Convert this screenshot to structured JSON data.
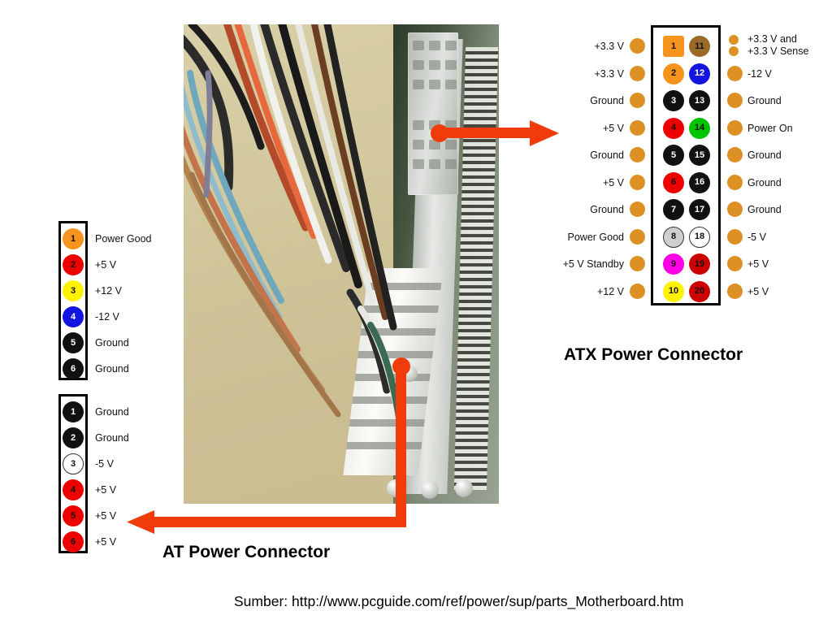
{
  "colors": {
    "arrow": "#F03C0A",
    "gold": "#DD9125",
    "orange": "#F7941E",
    "orange_dark": "#E8870E",
    "brown": "#9A6A28",
    "red": "#EE0000",
    "dark_red": "#CC0000",
    "yellow": "#FFF200",
    "blue": "#1414E0",
    "black": "#111111",
    "green": "#00C400",
    "gray": "#CFCFCF",
    "white": "#FFFFFF",
    "magenta": "#FF00E6",
    "box_border": "#000000",
    "photo_bg": "#CFC5A2"
  },
  "atx": {
    "title": "ATX Power Connector",
    "left_column": [
      {
        "pin": "1",
        "shape": "square",
        "color": "#F7941E",
        "num_color": "#111111",
        "label": "+3.3 V"
      },
      {
        "pin": "2",
        "shape": "circle",
        "color": "#F7941E",
        "num_color": "#111111",
        "label": "+3.3 V"
      },
      {
        "pin": "3",
        "shape": "circle",
        "color": "#111111",
        "num_color": "#FFFFFF",
        "label": "Ground"
      },
      {
        "pin": "4",
        "shape": "circle",
        "color": "#EE0000",
        "num_color": "#111111",
        "label": "+5 V"
      },
      {
        "pin": "5",
        "shape": "circle",
        "color": "#111111",
        "num_color": "#FFFFFF",
        "label": "Ground"
      },
      {
        "pin": "6",
        "shape": "circle",
        "color": "#EE0000",
        "num_color": "#111111",
        "label": "+5 V"
      },
      {
        "pin": "7",
        "shape": "circle",
        "color": "#111111",
        "num_color": "#FFFFFF",
        "label": "Ground"
      },
      {
        "pin": "8",
        "shape": "circle",
        "color": "#CFCFCF",
        "num_color": "#111111",
        "label": "Power Good"
      },
      {
        "pin": "9",
        "shape": "circle",
        "color": "#FF00E6",
        "num_color": "#111111",
        "label": "+5 V Standby"
      },
      {
        "pin": "10",
        "shape": "circle",
        "color": "#FFF200",
        "num_color": "#111111",
        "label": "+12 V"
      }
    ],
    "right_column": [
      {
        "pin": "11",
        "shape": "circle",
        "color": "#9A6A28",
        "num_color": "#111111",
        "label": "+3.3 V and\n+3.3 V Sense",
        "label_line1": "+3.3 V and",
        "label_line2": "+3.3 V Sense",
        "two_dots": true
      },
      {
        "pin": "12",
        "shape": "circle",
        "color": "#1414E0",
        "num_color": "#FFFFFF",
        "label": "-12 V"
      },
      {
        "pin": "13",
        "shape": "circle",
        "color": "#111111",
        "num_color": "#FFFFFF",
        "label": "Ground"
      },
      {
        "pin": "14",
        "shape": "circle",
        "color": "#00C400",
        "num_color": "#111111",
        "label": "Power On"
      },
      {
        "pin": "15",
        "shape": "circle",
        "color": "#111111",
        "num_color": "#FFFFFF",
        "label": "Ground"
      },
      {
        "pin": "16",
        "shape": "circle",
        "color": "#111111",
        "num_color": "#FFFFFF",
        "label": "Ground"
      },
      {
        "pin": "17",
        "shape": "circle",
        "color": "#111111",
        "num_color": "#FFFFFF",
        "label": "Ground"
      },
      {
        "pin": "18",
        "shape": "circle",
        "color": "#FFFFFF",
        "num_color": "#111111",
        "label": "-5 V"
      },
      {
        "pin": "19",
        "shape": "circle",
        "color": "#CC0000",
        "num_color": "#111111",
        "label": "+5 V"
      },
      {
        "pin": "20",
        "shape": "circle",
        "color": "#CC0000",
        "num_color": "#111111",
        "label": "+5 V"
      }
    ]
  },
  "at": {
    "title": "AT Power Connector",
    "p8": [
      {
        "pin": "1",
        "color": "#F7941E",
        "num_color": "#111111",
        "label": "Power Good"
      },
      {
        "pin": "2",
        "color": "#EE0000",
        "num_color": "#111111",
        "label": "+5 V"
      },
      {
        "pin": "3",
        "color": "#FFF200",
        "num_color": "#111111",
        "label": "+12 V"
      },
      {
        "pin": "4",
        "color": "#1414E0",
        "num_color": "#FFFFFF",
        "label": "-12 V"
      },
      {
        "pin": "5",
        "color": "#111111",
        "num_color": "#FFFFFF",
        "label": "Ground"
      },
      {
        "pin": "6",
        "color": "#111111",
        "num_color": "#FFFFFF",
        "label": "Ground"
      }
    ],
    "p9": [
      {
        "pin": "1",
        "color": "#111111",
        "num_color": "#FFFFFF",
        "label": "Ground"
      },
      {
        "pin": "2",
        "color": "#111111",
        "num_color": "#FFFFFF",
        "label": "Ground"
      },
      {
        "pin": "3",
        "color": "#FFFFFF",
        "num_color": "#111111",
        "label": "-5 V"
      },
      {
        "pin": "4",
        "color": "#EE0000",
        "num_color": "#111111",
        "label": "+5 V"
      },
      {
        "pin": "5",
        "color": "#EE0000",
        "num_color": "#111111",
        "label": "+5 V"
      },
      {
        "pin": "6",
        "color": "#EE0000",
        "num_color": "#111111",
        "label": "+5 V"
      }
    ]
  },
  "source": {
    "text": "Sumber: http://www.pcguide.com/ref/power/sup/parts_Motherboard.htm"
  },
  "photo": {
    "alt": "Motherboard photo with ATX power connector and AT power connector"
  }
}
